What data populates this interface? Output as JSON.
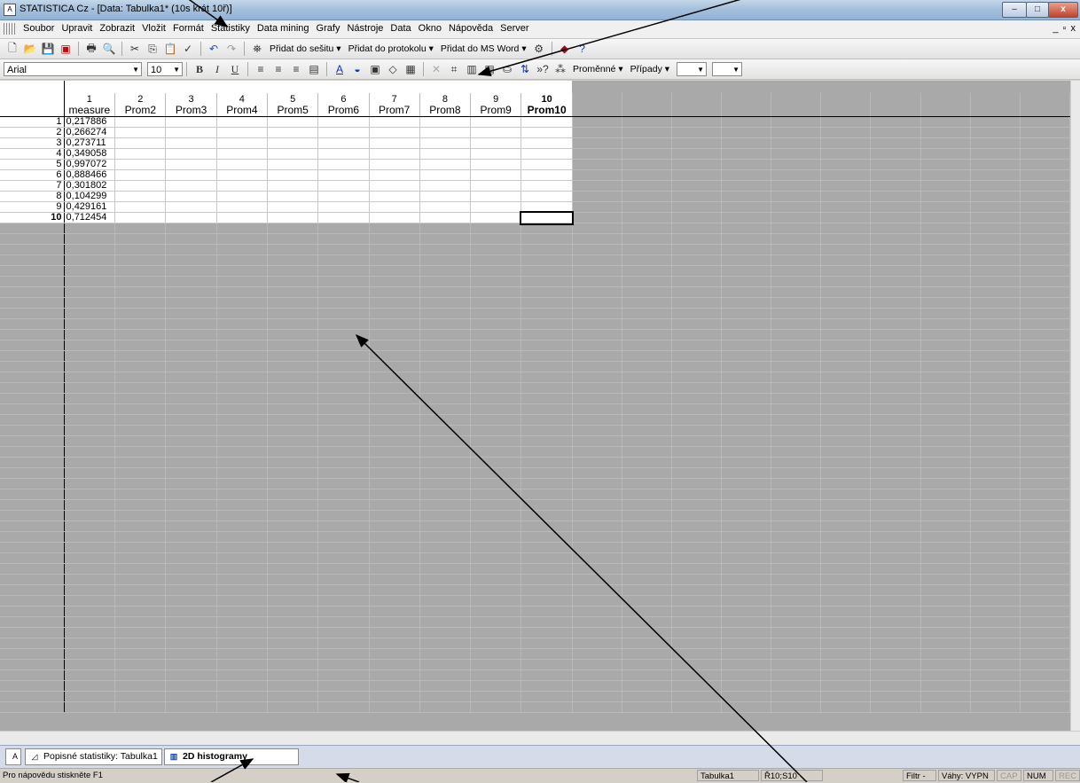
{
  "window": {
    "title": "STATISTICA Cz - [Data: Tabulka1* (10s krát 10ř)]",
    "app_icon": "statistica-icon",
    "buttons": {
      "minimize": "–",
      "maximize": "□",
      "close": "x"
    },
    "mdi_buttons": "_ ▫ x"
  },
  "menu": [
    "Soubor",
    "Upravit",
    "Zobrazit",
    "Vložit",
    "Formát",
    "Statistiky",
    "Data mining",
    "Grafy",
    "Nástroje",
    "Data",
    "Okno",
    "Nápověda",
    "Server"
  ],
  "toolbar1": {
    "add_workbook": "Přidat do sešitu ▾",
    "add_report": "Přidat do protokolu ▾",
    "add_word": "Přidat do MS Word ▾"
  },
  "toolbar2": {
    "font_name": "Arial",
    "font_size": "10",
    "bold": "B",
    "italic": "I",
    "underline": "U",
    "variables": "Proměnné ▾",
    "cases": "Případy ▾"
  },
  "spreadsheet": {
    "columns": [
      {
        "num": "1",
        "name": "measure"
      },
      {
        "num": "2",
        "name": "Prom2"
      },
      {
        "num": "3",
        "name": "Prom3"
      },
      {
        "num": "4",
        "name": "Prom4"
      },
      {
        "num": "5",
        "name": "Prom5"
      },
      {
        "num": "6",
        "name": "Prom6"
      },
      {
        "num": "7",
        "name": "Prom7"
      },
      {
        "num": "8",
        "name": "Prom8"
      },
      {
        "num": "9",
        "name": "Prom9"
      },
      {
        "num": "10",
        "name": "Prom10"
      }
    ],
    "rows": [
      {
        "num": "1",
        "values": [
          "0,217886",
          "",
          "",
          "",
          "",
          "",
          "",
          "",
          "",
          ""
        ]
      },
      {
        "num": "2",
        "values": [
          "0,266274",
          "",
          "",
          "",
          "",
          "",
          "",
          "",
          "",
          ""
        ]
      },
      {
        "num": "3",
        "values": [
          "0,273711",
          "",
          "",
          "",
          "",
          "",
          "",
          "",
          "",
          ""
        ]
      },
      {
        "num": "4",
        "values": [
          "0,349058",
          "",
          "",
          "",
          "",
          "",
          "",
          "",
          "",
          ""
        ]
      },
      {
        "num": "5",
        "values": [
          "0,997072",
          "",
          "",
          "",
          "",
          "",
          "",
          "",
          "",
          ""
        ]
      },
      {
        "num": "6",
        "values": [
          "0,888466",
          "",
          "",
          "",
          "",
          "",
          "",
          "",
          "",
          ""
        ]
      },
      {
        "num": "7",
        "values": [
          "0,301802",
          "",
          "",
          "",
          "",
          "",
          "",
          "",
          "",
          ""
        ]
      },
      {
        "num": "8",
        "values": [
          "0,104299",
          "",
          "",
          "",
          "",
          "",
          "",
          "",
          "",
          ""
        ]
      },
      {
        "num": "9",
        "values": [
          "0,429161",
          "",
          "",
          "",
          "",
          "",
          "",
          "",
          "",
          ""
        ]
      },
      {
        "num": "10",
        "values": [
          "0,712454",
          "",
          "",
          "",
          "",
          "",
          "",
          "",
          "",
          ""
        ]
      }
    ],
    "active_row": "10",
    "active_col": "10"
  },
  "tabs": [
    {
      "label": "Popisné statistiky: Tabulka1",
      "active": false
    },
    {
      "label": "2D histogramy",
      "active": true
    }
  ],
  "status": {
    "help": "Pro nápovědu stiskněte F1",
    "sheet": "Tabulka1",
    "cell": "Ř10;S10",
    "filter": "Filtr -",
    "weights": "Váhy: VYPN",
    "cap": "CAP",
    "num": "NUM",
    "rec": "REC"
  }
}
